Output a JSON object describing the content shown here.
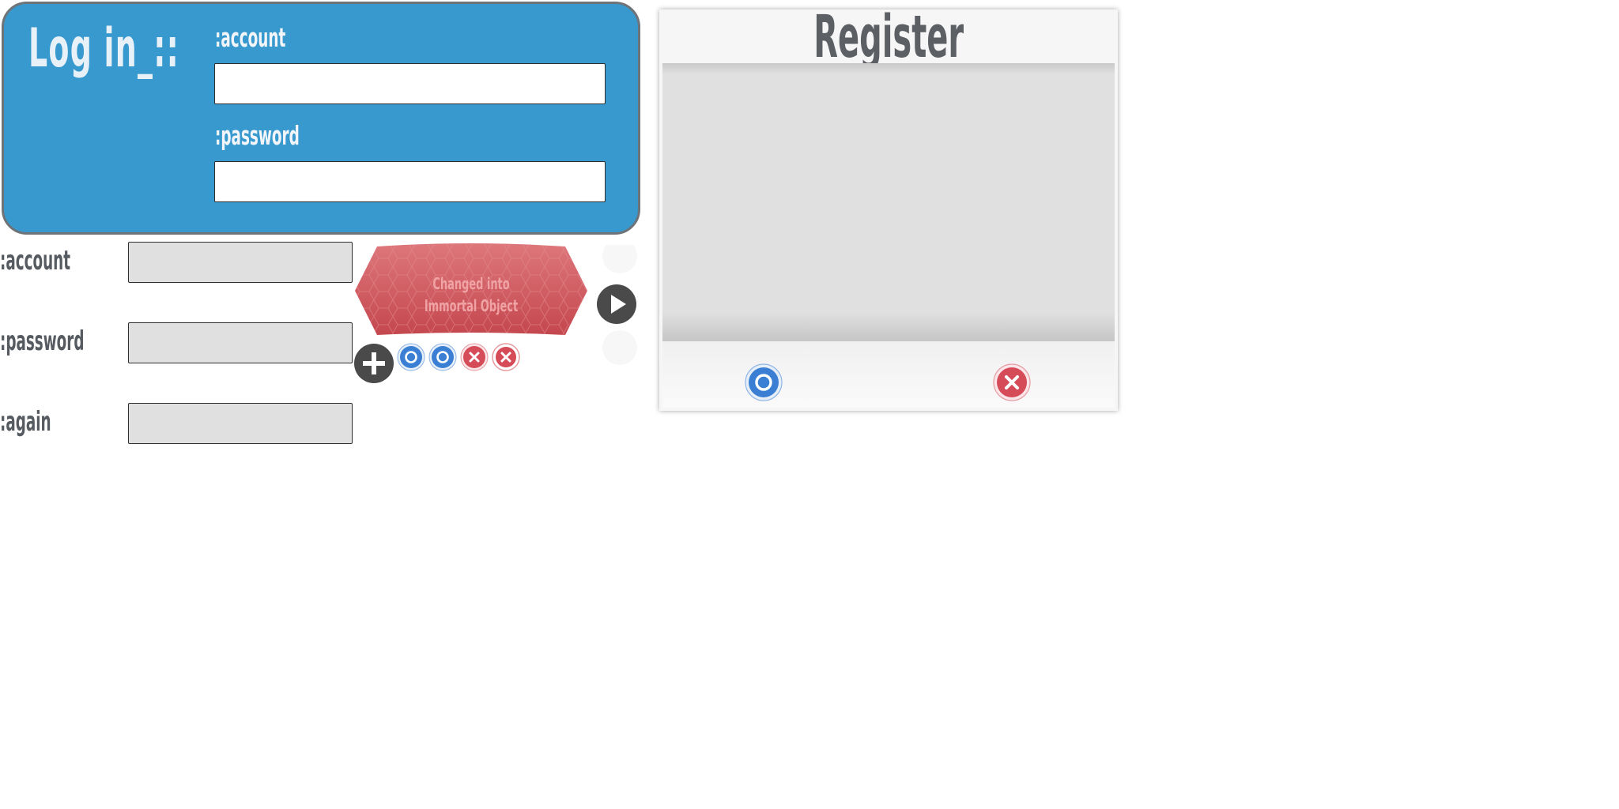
{
  "login": {
    "title": "Log in_::",
    "account_label": ":account",
    "account_value": "",
    "password_label": ":password",
    "password_value": ""
  },
  "register_form": {
    "account_label": ":account",
    "account_value": "",
    "password_label": ":password",
    "password_value": "",
    "again_label": ":again",
    "again_value": ""
  },
  "banner": {
    "line1": "Changed into",
    "line2": "Immortal Object"
  },
  "register_dialog": {
    "title": "Register"
  },
  "colors": {
    "login_panel": "#3899cf",
    "confirm_blue": "#3a7fd4",
    "cancel_red": "#d64b58",
    "banner_red": "#d96468",
    "dark_button": "#4a4a4a"
  },
  "icons": {
    "play": "play-icon",
    "add": "plus-icon",
    "confirm": "circle-o-icon",
    "cancel": "x-icon"
  }
}
